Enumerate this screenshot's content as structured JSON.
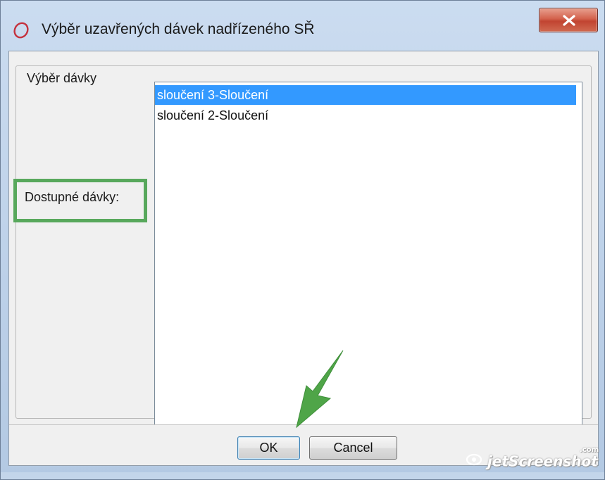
{
  "window": {
    "title": "Výběr uzavřených dávek nadřízeného SŘ",
    "close_label": "x"
  },
  "group": {
    "legend": "Výběr dávky",
    "available_label": "Dostupné dávky:",
    "items": [
      {
        "label": "sloučení 3-Sloučení",
        "selected": true
      },
      {
        "label": "sloučení 2-Sloučení",
        "selected": false
      }
    ]
  },
  "buttons": {
    "ok": "OK",
    "cancel": "Cancel"
  },
  "watermark": {
    "text": "jetScreenshot",
    "sub": ".com"
  },
  "colors": {
    "selection": "#3399ff",
    "annotation_green": "#58a85c",
    "close_button": "#c14431"
  },
  "icons": {
    "app": "oval-app-icon",
    "close": "close-x-icon",
    "annotation": "green-arrow-icon"
  }
}
